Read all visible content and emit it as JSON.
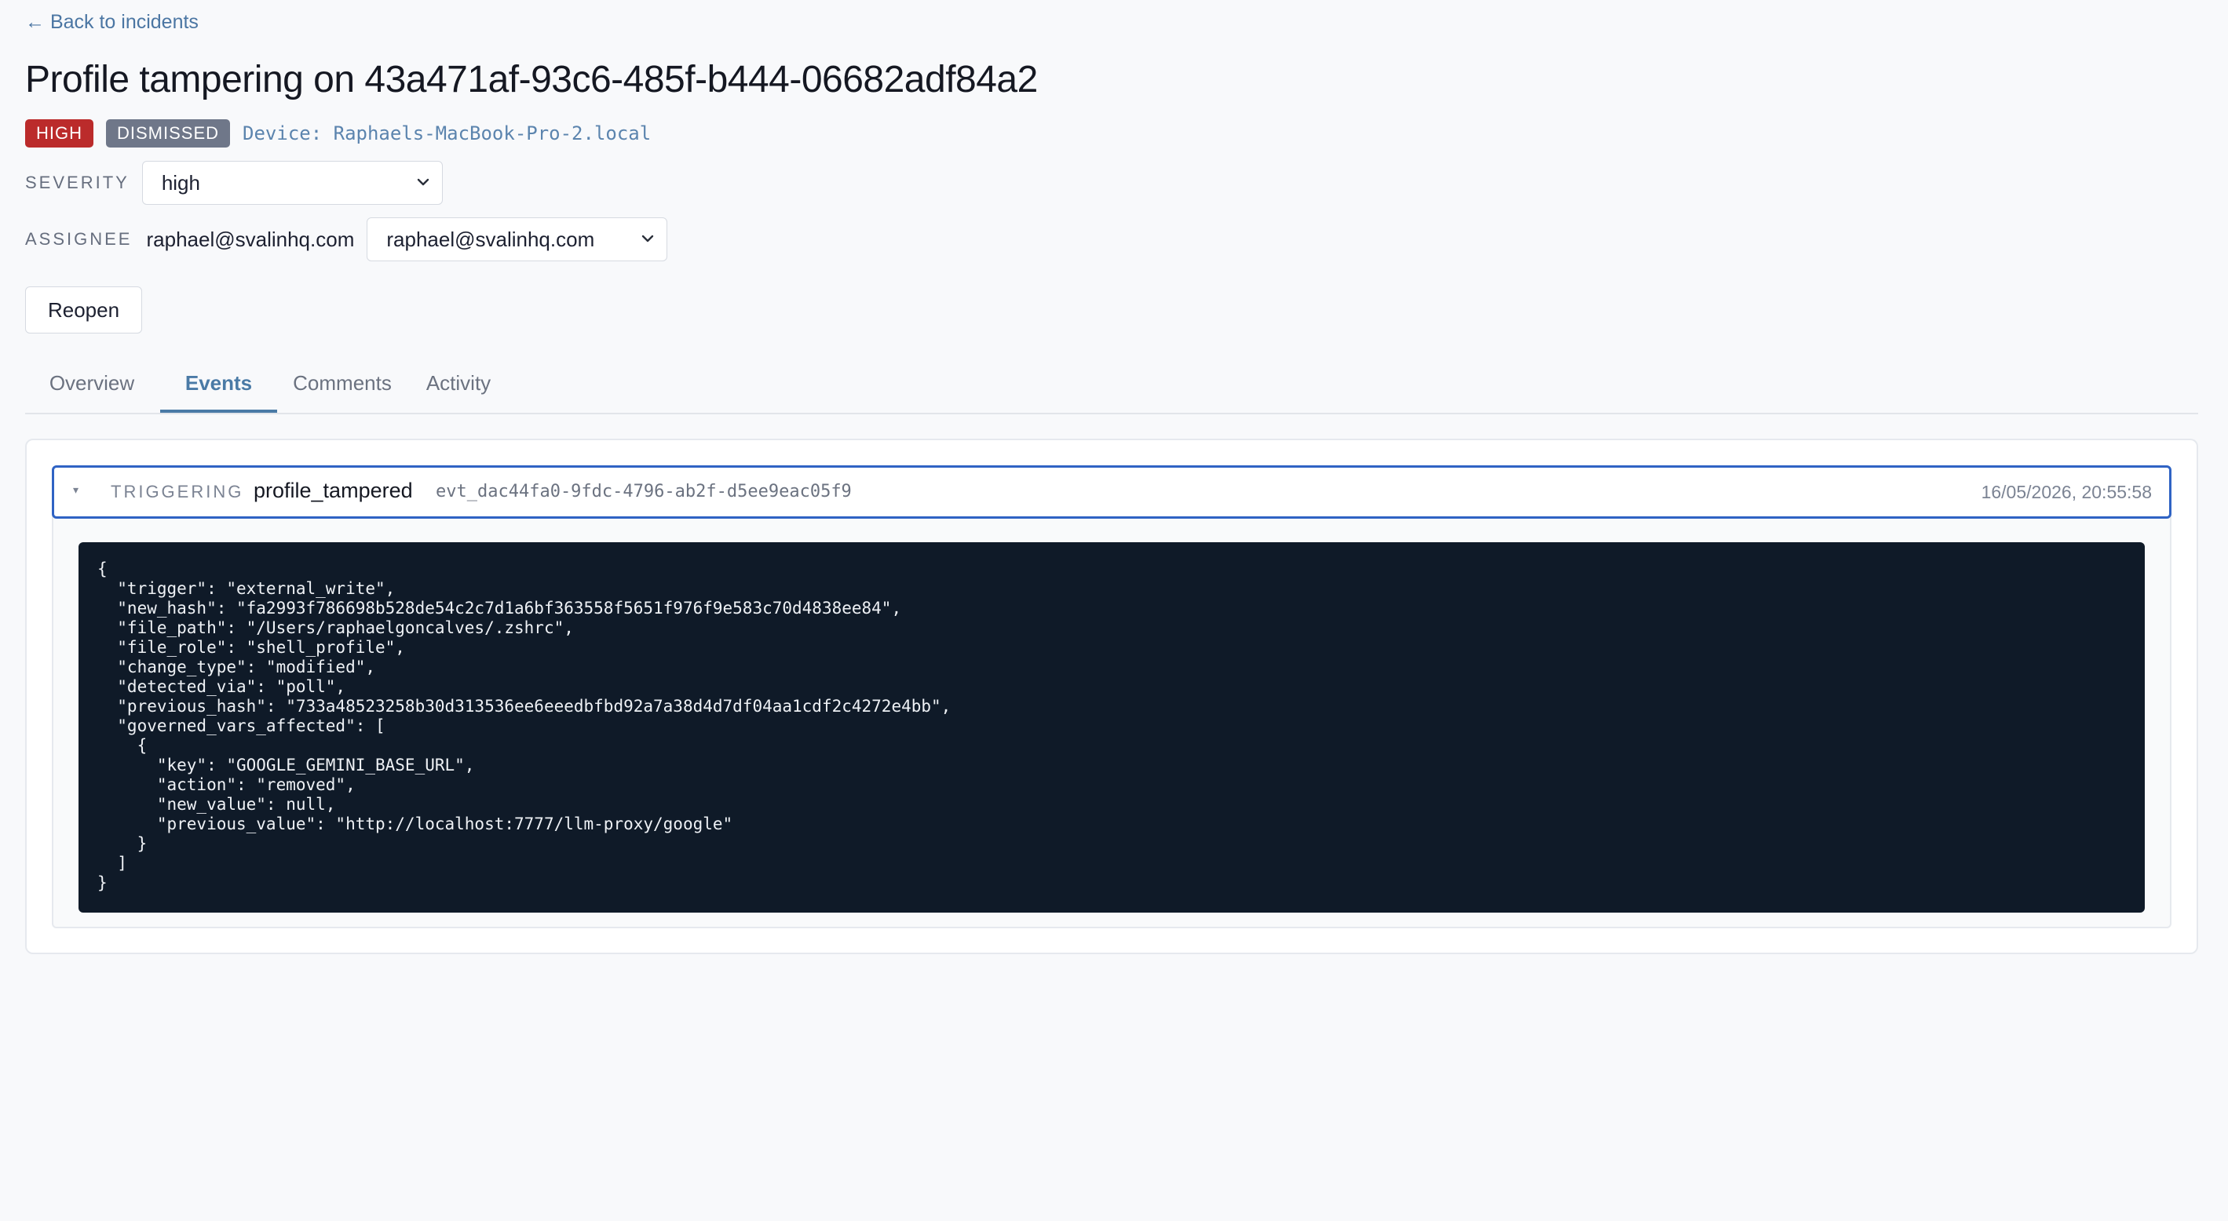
{
  "nav": {
    "back_label": "← Back to incidents"
  },
  "incident": {
    "title": "Profile tampering on 43a471af-93c6-485f-b444-06682adf84a2",
    "severity_badge": "HIGH",
    "status_badge": "DISMISSED",
    "device": "Device: Raphaels-MacBook-Pro-2.local"
  },
  "severity_field": {
    "label": "SEVERITY",
    "selected": "high"
  },
  "assignee_field": {
    "label": "ASSIGNEE",
    "current": "raphael@svalinhq.com",
    "selected": "raphael@svalinhq.com"
  },
  "actions": {
    "reopen_label": "Reopen"
  },
  "tabs": [
    {
      "label": "Overview",
      "active": false
    },
    {
      "label": "Events",
      "active": true
    },
    {
      "label": "Comments",
      "active": false
    },
    {
      "label": "Activity",
      "active": false
    }
  ],
  "events": [
    {
      "caret": "▾",
      "role": "TRIGGERING",
      "type": "profile_tampered",
      "id": "evt_dac44fa0-9fdc-4796-ab2f-d5ee9eac05f9",
      "timestamp": "16/05/2026, 20:55:58",
      "payload": "{\n  \"trigger\": \"external_write\",\n  \"new_hash\": \"fa2993f786698b528de54c2c7d1a6bf363558f5651f976f9e583c70d4838ee84\",\n  \"file_path\": \"/Users/raphaelgoncalves/.zshrc\",\n  \"file_role\": \"shell_profile\",\n  \"change_type\": \"modified\",\n  \"detected_via\": \"poll\",\n  \"previous_hash\": \"733a48523258b30d313536ee6eeedbfbd92a7a38d4d7df04aa1cdf2c4272e4bb\",\n  \"governed_vars_affected\": [\n    {\n      \"key\": \"GOOGLE_GEMINI_BASE_URL\",\n      \"action\": \"removed\",\n      \"new_value\": null,\n      \"previous_value\": \"http://localhost:7777/llm-proxy/google\"\n    }\n  ]\n}"
    }
  ],
  "colors": {
    "accent": "#4a7aa6",
    "severity_high": "#bb2b2b",
    "status_dismissed": "#6f7789",
    "code_bg": "#0f1a28",
    "focus_ring": "#2f63c4"
  }
}
